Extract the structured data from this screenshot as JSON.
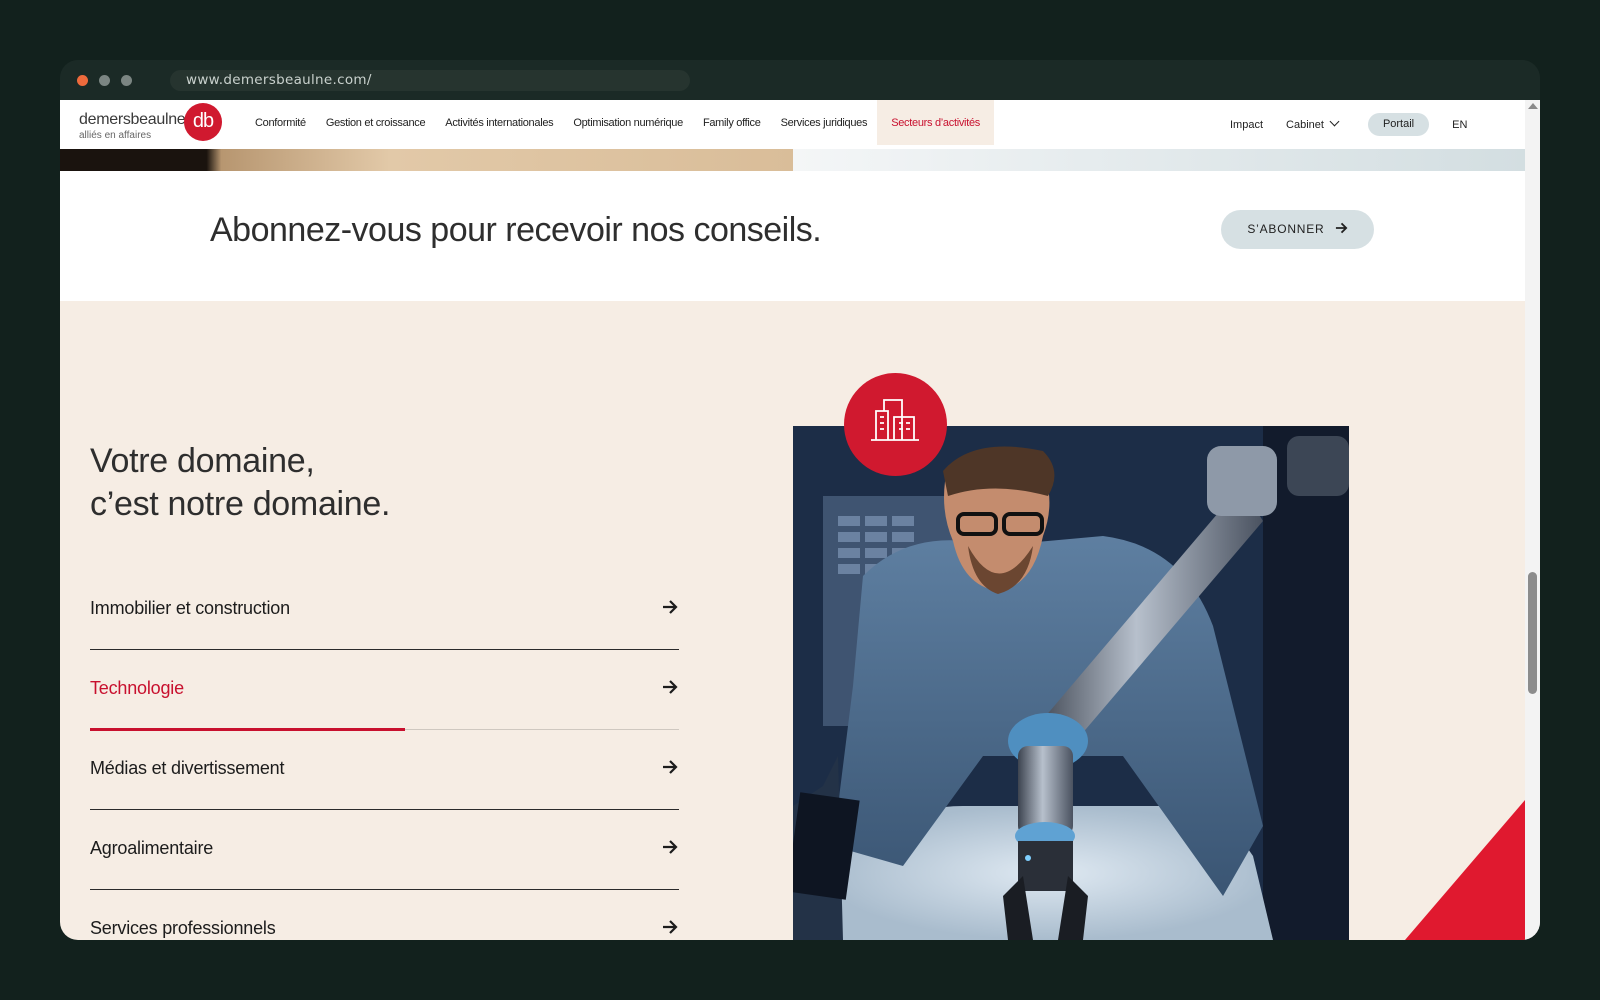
{
  "browser": {
    "url": "www.demersbeaulne.com/"
  },
  "header": {
    "logo_name": "demersbeaulne",
    "logo_tagline": "alliés en affaires",
    "logo_mark": "db",
    "nav": [
      {
        "label": "Conformité"
      },
      {
        "label": "Gestion et croissance"
      },
      {
        "label": "Activités internationales"
      },
      {
        "label": "Optimisation numérique"
      },
      {
        "label": "Family office"
      },
      {
        "label": "Services juridiques"
      },
      {
        "label": "Secteurs d’activités"
      }
    ],
    "right": {
      "impact": "Impact",
      "cabinet": "Cabinet",
      "portal": "Portail",
      "lang": "EN"
    }
  },
  "subscribe": {
    "title": "Abonnez-vous pour recevoir nos conseils.",
    "button": "S’ABONNER"
  },
  "domain": {
    "heading_line1": "Votre domaine,",
    "heading_line2": "c’est notre domaine.",
    "sectors": [
      {
        "label": "Immobilier et construction"
      },
      {
        "label": "Technologie"
      },
      {
        "label": "Médias et divertissement"
      },
      {
        "label": "Agroalimentaire"
      },
      {
        "label": "Services professionnels"
      }
    ],
    "active_progress_fraction": 0.535
  },
  "colors": {
    "brand_red": "#d0192f",
    "active_red": "#c8102e",
    "beige": "#f6ede4",
    "pill": "#d6e0e3"
  },
  "icons": {
    "badge": "buildings-icon",
    "sector_arrow": "arrow-right-icon",
    "cabinet": "chevron-down-icon"
  }
}
